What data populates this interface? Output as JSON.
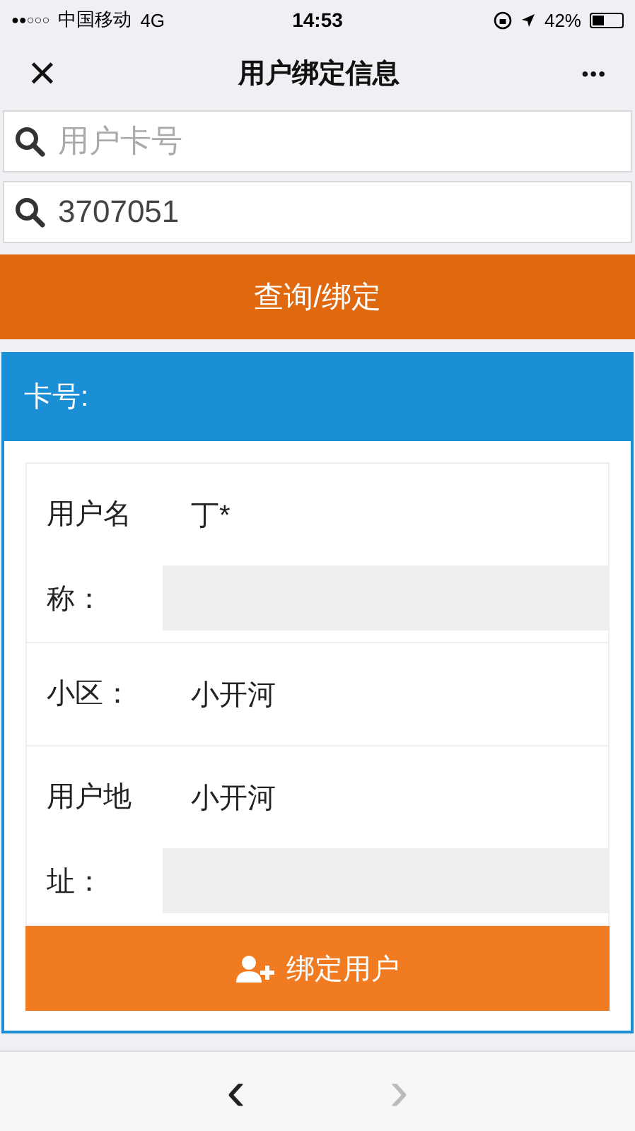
{
  "status_bar": {
    "signal": "●●○○○",
    "carrier": "中国移动",
    "network": "4G",
    "time": "14:53",
    "battery": "42%"
  },
  "nav": {
    "close": "×",
    "title": "用户绑定信息",
    "more": "•••"
  },
  "search_fields": [
    {
      "placeholder": "用户卡号"
    },
    {
      "value": "3707051"
    }
  ],
  "query_button": "查询/绑定",
  "panel": {
    "header": "卡号:",
    "rows": [
      {
        "label": "用户名称：",
        "value": "丁*",
        "kind": "boxed"
      },
      {
        "label": "小区：",
        "value": "小开河",
        "kind": "plain"
      },
      {
        "label": "用户地址：",
        "value": "小开河",
        "kind": "boxed"
      }
    ],
    "bind_button": "绑定用户"
  },
  "toolbar": {
    "back": {
      "label": "‹",
      "disabled": false
    },
    "forward": {
      "label": "›",
      "disabled": true
    }
  }
}
